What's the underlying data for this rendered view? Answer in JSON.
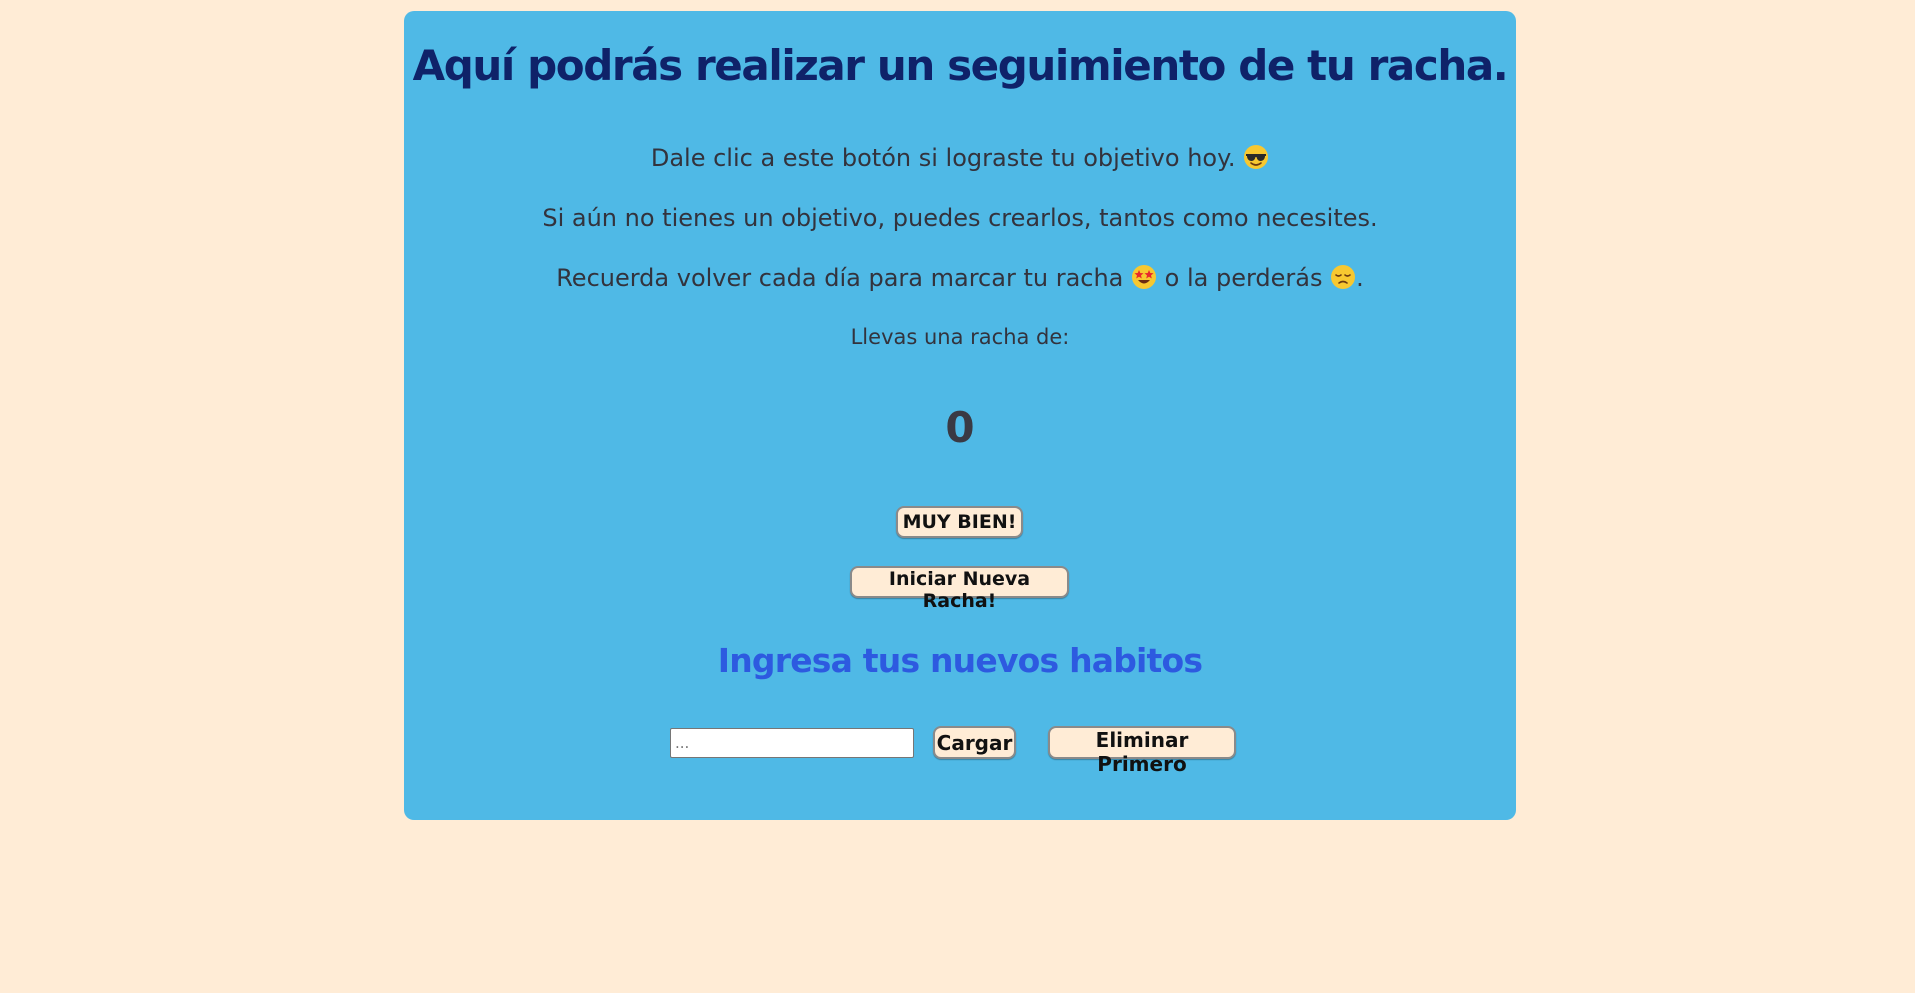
{
  "main": {
    "title": "Aquí podrás realizar un seguimiento de tu racha.",
    "intro_line1": "Dale clic a este botón si lograste tu objetivo hoy.",
    "intro_line1_emoji": "sunglasses-emoji",
    "intro_line2": "Si aún no tienes un objetivo, puedes crearlos, tantos como necesites.",
    "intro_line3_part1": "Recuerda volver cada día para marcar tu racha",
    "intro_line3_emoji1": "star-struck-emoji",
    "intro_line3_part2": "o la perderás",
    "intro_line3_emoji2": "sad-emoji",
    "intro_line3_end": ".",
    "streak_label": "Llevas una racha de:",
    "streak_value": "0",
    "done_button": "MUY BIEN!",
    "new_streak_button": "Iniciar Nueva Racha!"
  },
  "habits": {
    "heading": "Ingresa tus nuevos habitos",
    "input_placeholder": "...",
    "input_value": "",
    "add_button": "Cargar",
    "remove_first_button": "Eliminar Primero"
  },
  "colors": {
    "page_background": "#ffecd6",
    "card_background": "#4fb9e6",
    "title": "#0f2269",
    "subtitle": "#2d5ae0",
    "button_background": "#ffecd6"
  }
}
